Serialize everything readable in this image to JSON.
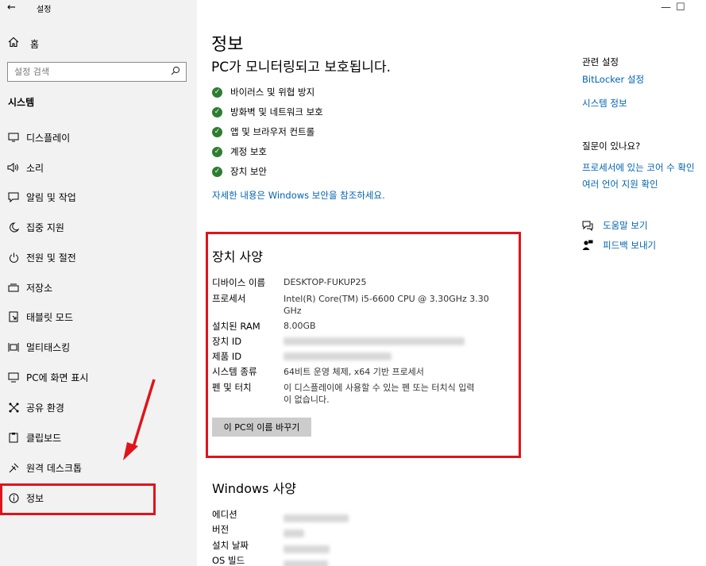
{
  "window": {
    "title": "설정",
    "minimize": "—",
    "maximize": "☐"
  },
  "sidebar": {
    "home_label": "홈",
    "search_placeholder": "설정 검색",
    "section": "시스템",
    "items": [
      {
        "label": "디스플레이",
        "icon": "monitor-icon"
      },
      {
        "label": "소리",
        "icon": "speaker-icon"
      },
      {
        "label": "알림 및 작업",
        "icon": "notification-icon"
      },
      {
        "label": "집중 지원",
        "icon": "moon-icon"
      },
      {
        "label": "전원 및 절전",
        "icon": "power-icon"
      },
      {
        "label": "저장소",
        "icon": "storage-icon"
      },
      {
        "label": "태블릿 모드",
        "icon": "tablet-icon"
      },
      {
        "label": "멀티태스킹",
        "icon": "multitask-icon"
      },
      {
        "label": "PC에 화면 표시",
        "icon": "project-icon"
      },
      {
        "label": "공유 환경",
        "icon": "share-icon"
      },
      {
        "label": "클립보드",
        "icon": "clipboard-icon"
      },
      {
        "label": "원격 데스크톱",
        "icon": "remote-icon"
      },
      {
        "label": "정보",
        "icon": "info-icon",
        "selected": true
      }
    ]
  },
  "main": {
    "title": "정보",
    "protection_heading": "PC가 모니터링되고 보호됩니다.",
    "protection_items": [
      "바이러스 및 위협 방지",
      "방화벽 및 네트워크 보호",
      "앱 및 브라우저 컨트롤",
      "계정 보호",
      "장치 보안"
    ],
    "security_link": "자세한 내용은 Windows 보안을 참조하세요.",
    "device_specs": {
      "heading": "장치 사양",
      "device_name_label": "디바이스 이름",
      "device_name": "DESKTOP-FUKUP25",
      "processor_label": "프로세서",
      "processor_line1": "Intel(R) Core(TM) i5-6600 CPU @ 3.30GHz   3.30",
      "processor_line2": "GHz",
      "ram_label": "설치된 RAM",
      "ram": "8.00GB",
      "device_id_label": "장치 ID",
      "product_id_label": "제품 ID",
      "system_type_label": "시스템 종류",
      "system_type": "64비트 운영 체제, x64 기반 프로세서",
      "pen_touch_label": "펜 및 터치",
      "pen_touch_line1": "이 디스플레이에 사용할 수 있는 펜 또는 터치식 입력",
      "pen_touch_line2": "이 없습니다.",
      "rename_button": "이 PC의 이름 바꾸기"
    },
    "windows_specs": {
      "heading": "Windows 사양",
      "edition_label": "에디션",
      "version_label": "버전",
      "install_date_label": "설치 날짜",
      "os_build_label": "OS 빌드"
    }
  },
  "right_panel": {
    "related_heading": "관련 설정",
    "bitlocker_link": "BitLocker 설정",
    "system_info_link": "시스템 정보",
    "question_heading": "질문이 있나요?",
    "cores_link": "프로세서에 있는 코어 수 확인",
    "multilang_link": "여러 언어 지원 확인",
    "help_link": "도움말 보기",
    "feedback_link": "피드백 보내기"
  },
  "colors": {
    "accent": "#0063b1",
    "annotation": "#e0131b",
    "check": "#2e7d32",
    "sidebar_bg": "#f2f2f2"
  }
}
